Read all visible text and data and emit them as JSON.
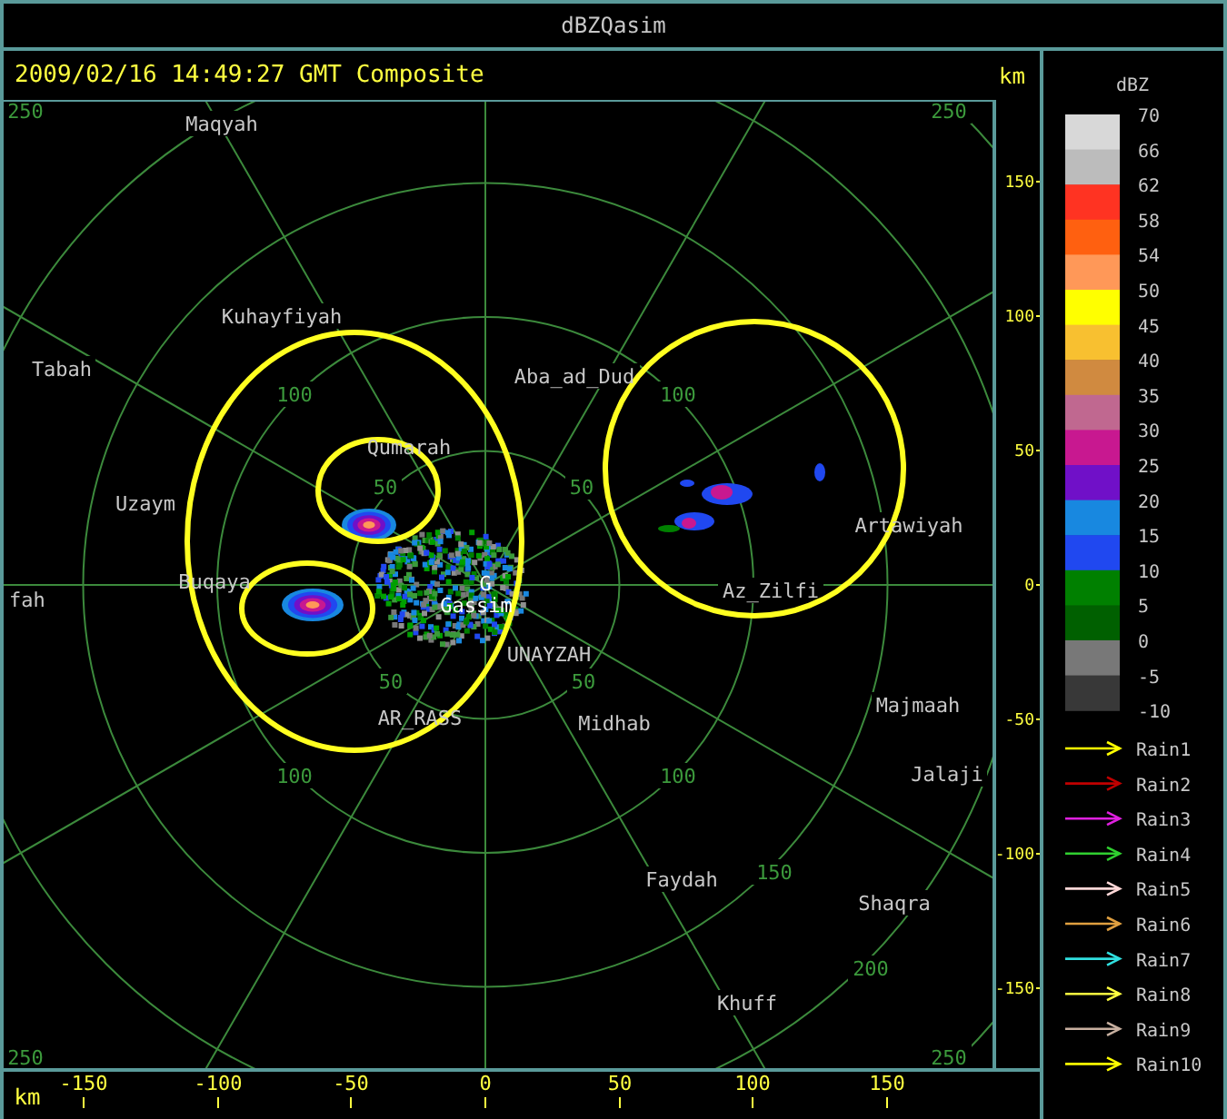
{
  "window": {
    "title": "dBZQasim"
  },
  "header": {
    "timestamp": "2009/02/16 14:49:27 GMT Composite",
    "unit": "km"
  },
  "map": {
    "cities": [
      "Maqyah",
      "Kuhayfiyah",
      "Tabah",
      "Aba_ad_Dud",
      "Qumarah",
      "Uzaym",
      "Artawiyah",
      "fah",
      "Buqaya",
      "Az_Zilfi",
      "G",
      "Gassim",
      "UNAYZAH",
      "AR_RASS",
      "Midhab",
      "Majmaah",
      "Jalaji",
      "Faydah",
      "Shaqra",
      "Khuff"
    ],
    "ring_labels": [
      "250",
      "250",
      "100",
      "100",
      "50",
      "50",
      "50",
      "50",
      "100",
      "100",
      "150",
      "200",
      "250",
      "250"
    ]
  },
  "right_axis": {
    "ticks": [
      "150",
      "100",
      "50",
      "0",
      "-50",
      "-100",
      "-150"
    ]
  },
  "bottom_axis": {
    "unit": "km",
    "ticks": [
      "-150",
      "-100",
      "-50",
      "0",
      "50",
      "100",
      "150"
    ]
  },
  "legend": {
    "title": "dBZ",
    "labels": [
      "70",
      "66",
      "62",
      "58",
      "54",
      "50",
      "45",
      "40",
      "35",
      "30",
      "25",
      "20",
      "15",
      "10",
      "5",
      "0",
      "-5",
      "-10"
    ],
    "bands": [
      {
        "color": "#d8d8d8"
      },
      {
        "color": "#bcbcbc"
      },
      {
        "color": "#ff3322"
      },
      {
        "color": "#ff6010"
      },
      {
        "color": "#ff9858"
      },
      {
        "color": "#ffff00"
      },
      {
        "color": "#f8c030"
      },
      {
        "color": "#d08a40"
      },
      {
        "color": "#c06890"
      },
      {
        "color": "#c81890"
      },
      {
        "color": "#7010c8"
      },
      {
        "color": "#1888e0"
      },
      {
        "color": "#2048f0"
      },
      {
        "color": "#008000"
      },
      {
        "color": "#006000"
      },
      {
        "color": "#787878"
      },
      {
        "color": "#383838"
      }
    ],
    "rain": [
      {
        "label": "Rain1",
        "color": "#ffff00"
      },
      {
        "label": "Rain2",
        "color": "#c00000"
      },
      {
        "label": "Rain3",
        "color": "#e020e0"
      },
      {
        "label": "Rain4",
        "color": "#30d030"
      },
      {
        "label": "Rain5",
        "color": "#ffd8d8"
      },
      {
        "label": "Rain6",
        "color": "#e0a040"
      },
      {
        "label": "Rain7",
        "color": "#30e0e0"
      },
      {
        "label": "Rain8",
        "color": "#ffff40"
      },
      {
        "label": "Rain9",
        "color": "#c8b0a0"
      },
      {
        "label": "Rain10",
        "color": "#ffff00"
      }
    ]
  }
}
